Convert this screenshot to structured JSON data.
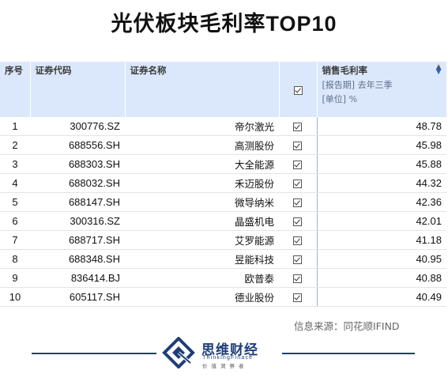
{
  "title": {
    "cn": "光伏板块毛利率",
    "en": "TOP10"
  },
  "table": {
    "headers": {
      "index": "序号",
      "code": "证券代码",
      "name": "证券名称",
      "metric": "销售毛利率",
      "metric_sub1": "[报告期] 去年三季",
      "metric_sub2": "[单位] %"
    },
    "rows": [
      {
        "index": "1",
        "code": "300776.SZ",
        "name": "帝尔激光",
        "value": "48.78"
      },
      {
        "index": "2",
        "code": "688556.SH",
        "name": "高测股份",
        "value": "45.98"
      },
      {
        "index": "3",
        "code": "688303.SH",
        "name": "大全能源",
        "value": "45.88"
      },
      {
        "index": "4",
        "code": "688032.SH",
        "name": "禾迈股份",
        "value": "44.32"
      },
      {
        "index": "5",
        "code": "688147.SH",
        "name": "微导纳米",
        "value": "42.36"
      },
      {
        "index": "6",
        "code": "300316.SZ",
        "name": "晶盛机电",
        "value": "42.01"
      },
      {
        "index": "7",
        "code": "688717.SH",
        "name": "艾罗能源",
        "value": "41.18"
      },
      {
        "index": "8",
        "code": "688348.SH",
        "name": "昱能科技",
        "value": "40.95"
      },
      {
        "index": "9",
        "code": "836414.BJ",
        "name": "欧普泰",
        "value": "40.88"
      },
      {
        "index": "10",
        "code": "605117.SH",
        "name": "德业股份",
        "value": "40.49"
      }
    ]
  },
  "source": "信息来源：同花顺IFIND",
  "brand": {
    "name": "思维财经",
    "en": "ThinkingFinace",
    "motto": "价值洞察者",
    "color": "#1f3e78"
  },
  "colors": {
    "header_bg": "#dbe7fb",
    "sort_arrow": "#2563d6"
  },
  "icons": {
    "checkbox": "checkbox-checked-icon",
    "sort": "sort-desc-icon"
  }
}
